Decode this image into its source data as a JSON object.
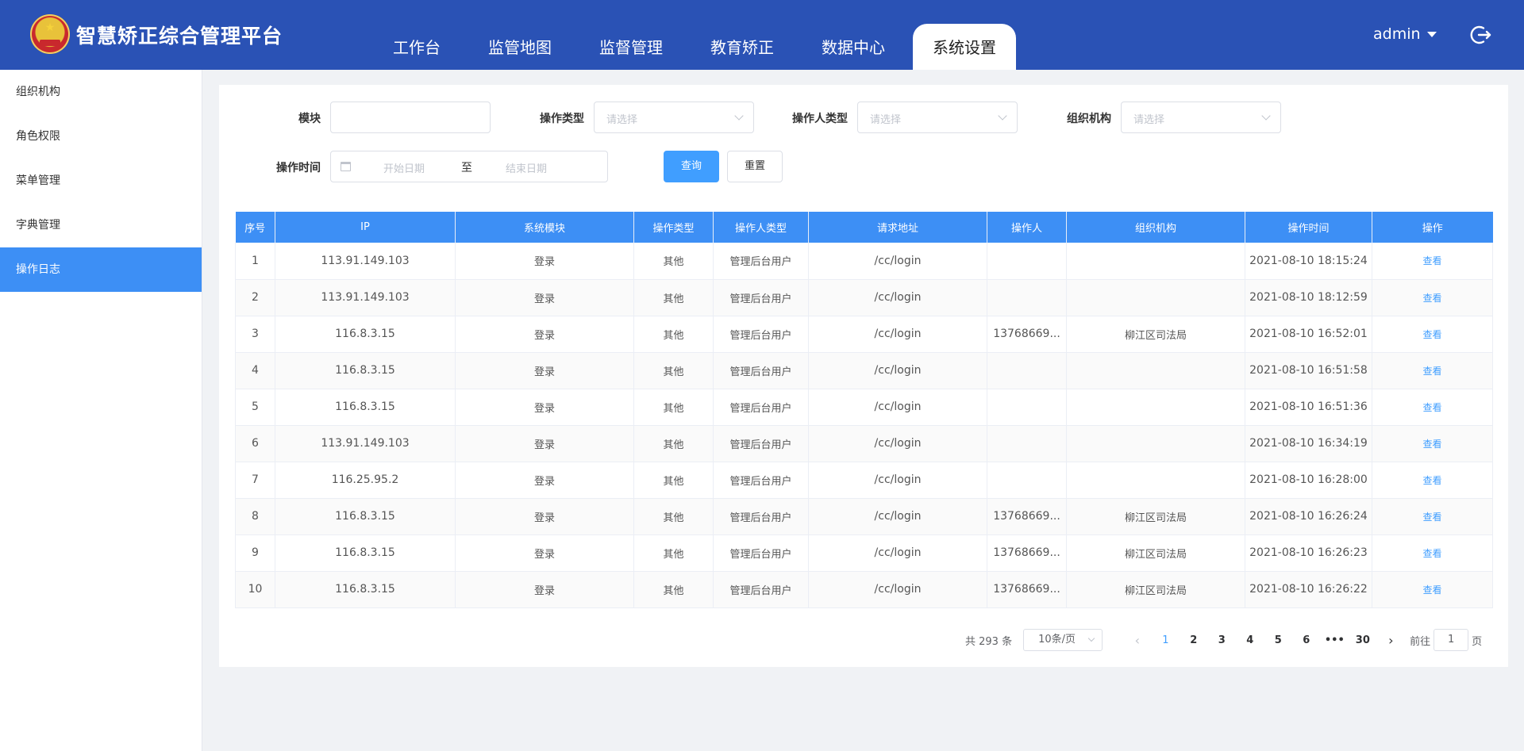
{
  "app": {
    "title": "智慧矫正综合管理平台"
  },
  "nav": [
    "工作台",
    "监管地图",
    "监督管理",
    "教育矫正",
    "数据中心",
    "系统设置"
  ],
  "nav_active_index": 5,
  "user": {
    "name": "admin"
  },
  "sidebar": {
    "items": [
      "组织机构",
      "角色权限",
      "菜单管理",
      "字典管理",
      "操作日志"
    ],
    "active_index": 4
  },
  "filters": {
    "module_label": "模块",
    "module_value": "",
    "op_type_label": "操作类型",
    "op_type_placeholder": "请选择",
    "operator_type_label": "操作人类型",
    "operator_type_placeholder": "请选择",
    "org_label": "组织机构",
    "org_placeholder": "请选择",
    "time_label": "操作时间",
    "start_placeholder": "开始日期",
    "range_sep": "至",
    "end_placeholder": "结束日期",
    "search_label": "查询",
    "reset_label": "重置"
  },
  "table": {
    "columns": [
      "序号",
      "IP",
      "系统模块",
      "操作类型",
      "操作人类型",
      "请求地址",
      "操作人",
      "组织机构",
      "操作时间",
      "操作"
    ],
    "action_label": "查看",
    "rows": [
      [
        "1",
        "113.91.149.103",
        "登录",
        "其他",
        "管理后台用户",
        "/cc/login",
        "",
        "",
        "2021-08-10 18:15:24"
      ],
      [
        "2",
        "113.91.149.103",
        "登录",
        "其他",
        "管理后台用户",
        "/cc/login",
        "",
        "",
        "2021-08-10 18:12:59"
      ],
      [
        "3",
        "116.8.3.15",
        "登录",
        "其他",
        "管理后台用户",
        "/cc/login",
        "13768669...",
        "柳江区司法局",
        "2021-08-10 16:52:01"
      ],
      [
        "4",
        "116.8.3.15",
        "登录",
        "其他",
        "管理后台用户",
        "/cc/login",
        "",
        "",
        "2021-08-10 16:51:58"
      ],
      [
        "5",
        "116.8.3.15",
        "登录",
        "其他",
        "管理后台用户",
        "/cc/login",
        "",
        "",
        "2021-08-10 16:51:36"
      ],
      [
        "6",
        "113.91.149.103",
        "登录",
        "其他",
        "管理后台用户",
        "/cc/login",
        "",
        "",
        "2021-08-10 16:34:19"
      ],
      [
        "7",
        "116.25.95.2",
        "登录",
        "其他",
        "管理后台用户",
        "/cc/login",
        "",
        "",
        "2021-08-10 16:28:00"
      ],
      [
        "8",
        "116.8.3.15",
        "登录",
        "其他",
        "管理后台用户",
        "/cc/login",
        "13768669...",
        "柳江区司法局",
        "2021-08-10 16:26:24"
      ],
      [
        "9",
        "116.8.3.15",
        "登录",
        "其他",
        "管理后台用户",
        "/cc/login",
        "13768669...",
        "柳江区司法局",
        "2021-08-10 16:26:23"
      ],
      [
        "10",
        "116.8.3.15",
        "登录",
        "其他",
        "管理后台用户",
        "/cc/login",
        "13768669...",
        "柳江区司法局",
        "2021-08-10 16:26:22"
      ]
    ]
  },
  "pagination": {
    "total_text": "共 293 条",
    "page_size": "10条/页",
    "pages": [
      "1",
      "2",
      "3",
      "4",
      "5",
      "6",
      "•••",
      "30"
    ],
    "current_page": "1",
    "goto_label": "前往",
    "goto_value": "1",
    "goto_suffix": "页"
  },
  "colors": {
    "header_bg": "#2a52b5",
    "accent": "#3d8ff5",
    "link": "#409eff"
  }
}
